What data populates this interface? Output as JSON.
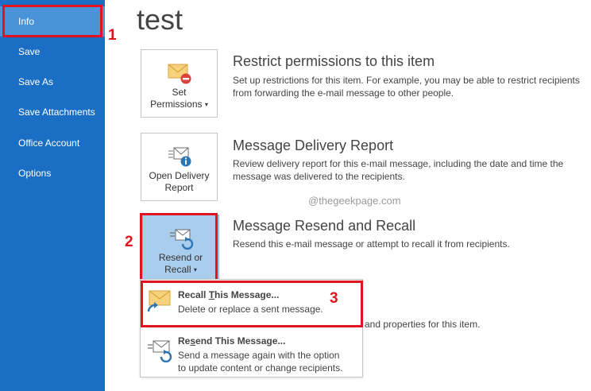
{
  "sidebar": {
    "items": [
      {
        "label": "Info",
        "active": true
      },
      {
        "label": "Save"
      },
      {
        "label": "Save As"
      },
      {
        "label": "Save Attachments"
      },
      {
        "label": "Office Account"
      },
      {
        "label": "Options"
      }
    ]
  },
  "page": {
    "title": "test"
  },
  "sections": {
    "permissions": {
      "button_line1": "Set",
      "button_line2": "Permissions",
      "heading": "Restrict permissions to this item",
      "desc": "Set up restrictions for this item. For example, you may be able to restrict recipients from forwarding the e-mail message to other people."
    },
    "delivery": {
      "button_line1": "Open Delivery",
      "button_line2": "Report",
      "heading": "Message Delivery Report",
      "desc": "Review delivery report for this e-mail message, including the date and time the message was delivered to the recipients."
    },
    "resend": {
      "button_line1": "Resend or",
      "button_line2": "Recall",
      "heading": "Message Resend and Recall",
      "desc": "Resend this e-mail message or attempt to recall it from recipients."
    }
  },
  "watermark": "@thegeekpage.com",
  "behind_text": "and properties for this item.",
  "menu": {
    "recall": {
      "title_pre": "Recall ",
      "title_u": "T",
      "title_post": "his Message...",
      "desc": "Delete or replace a sent message."
    },
    "resend": {
      "title_pre": "Re",
      "title_u": "s",
      "title_post": "end This Message...",
      "desc_line1": "Send a message again with the option",
      "desc_line2": "to update content or change recipients."
    }
  },
  "annotations": {
    "step1": "1",
    "step2": "2",
    "step3": "3"
  },
  "colors": {
    "sidebar": "#1a6fc4",
    "sidebar_active": "#4a93d8",
    "highlight": "#e3121f",
    "pressed_button": "#a9cdec"
  },
  "icons": {
    "permissions": "envelope-no-entry-icon",
    "delivery": "envelope-info-icon",
    "resend": "envelope-refresh-icon",
    "recall": "envelope-recall-icon",
    "resend_item": "envelope-resend-icon"
  }
}
